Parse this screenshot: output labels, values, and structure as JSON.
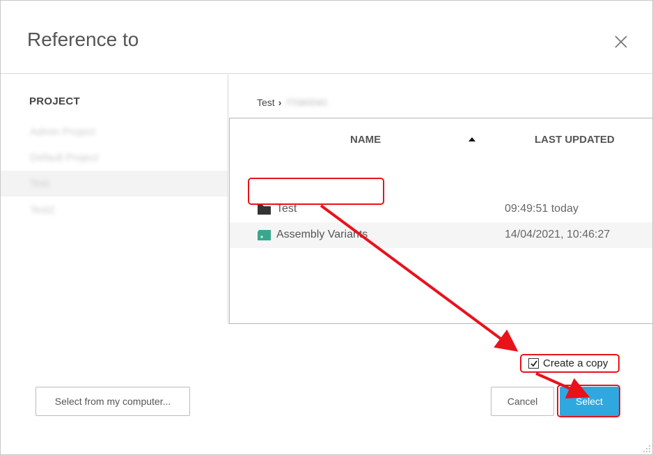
{
  "dialog": {
    "title": "Reference to",
    "close_icon": "close-icon"
  },
  "sidebar": {
    "heading": "PROJECT",
    "items": [
      {
        "label": "Admin Project",
        "active": false
      },
      {
        "label": "Default Project",
        "active": false
      },
      {
        "label": "Test",
        "active": true
      },
      {
        "label": "Test2",
        "active": false
      }
    ]
  },
  "breadcrumb": {
    "root": "Test",
    "separator_icon": "chevron-right-icon",
    "current": "f7080040"
  },
  "table": {
    "columns": {
      "name": "NAME",
      "updated": "LAST UPDATED"
    },
    "sort_icon": "sort-ascending-icon",
    "rows": [
      {
        "icon": "folder-icon",
        "name": "Test",
        "updated": "09:49:51 today"
      },
      {
        "icon": "assembly-icon",
        "name": "Assembly Variants",
        "updated": "14/04/2021, 10:46:27"
      }
    ]
  },
  "footer": {
    "checkbox_label": "Create a copy",
    "checkbox_checked": true,
    "upload_label": "Select from my computer...",
    "cancel_label": "Cancel",
    "select_label": "Select"
  },
  "colors": {
    "primary": "#2fa8e0",
    "annotation": "#e8121b",
    "assembly_icon": "#3aa68e"
  }
}
